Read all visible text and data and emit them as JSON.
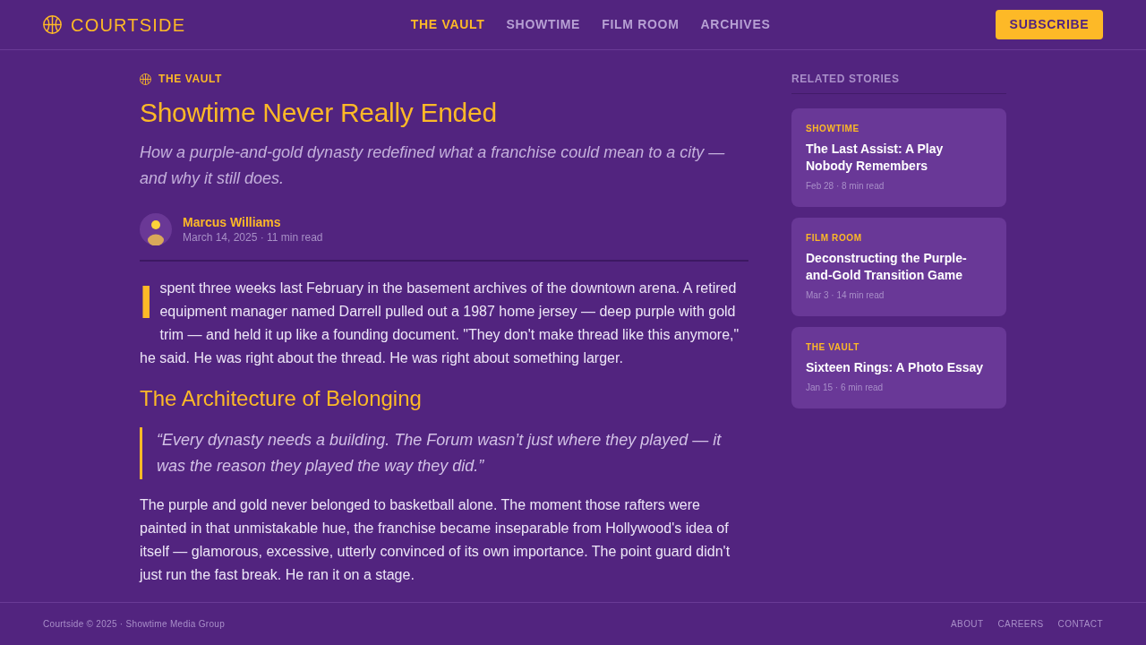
{
  "header": {
    "logo": "COURTSIDE",
    "nav": [
      {
        "label": "THE VAULT",
        "selected": true
      },
      {
        "label": "SHOWTIME",
        "selected": false
      },
      {
        "label": "FILM ROOM",
        "selected": false
      },
      {
        "label": "ARCHIVES",
        "selected": false
      }
    ],
    "subscribe": "SUBSCRIBE"
  },
  "article": {
    "kicker": "THE VAULT",
    "title": "Showtime Never Really Ended",
    "subtitle": "How a purple-and-gold dynasty redefined what a franchise could mean to a city — and why it still does.",
    "author": {
      "name": "Marcus Williams",
      "meta": "March 14, 2025 · 11 min read"
    },
    "body": [
      {
        "kind": "paragraph",
        "drop_cap": true,
        "text": "I spent three weeks last February in the basement archives of the downtown arena. A retired equipment manager named Darrell pulled out a 1987 home jersey — deep purple with gold trim — and held it up like a founding document. \"They don't make thread like this anymore,\" he said. He was right about the thread. He was right about something larger."
      },
      {
        "kind": "heading",
        "text": "The Architecture of Belonging"
      },
      {
        "kind": "quote",
        "text": "“Every dynasty needs a building. The Forum wasn’t just where they played — it was the reason they played the way they did.”"
      },
      {
        "kind": "paragraph",
        "drop_cap": false,
        "text": "The purple and gold never belonged to basketball alone. The moment those rafters were painted in that unmistakable hue, the franchise became inseparable from Hollywood's idea of itself — glamorous, excessive, utterly convinced of its own importance. The point guard didn't just run the fast break. He ran it on a stage."
      }
    ]
  },
  "sidebar": {
    "title": "RELATED STORIES",
    "stories": [
      {
        "category": "SHOWTIME",
        "title": "The Last Assist: A Play Nobody Remembers",
        "meta": "Feb 28 · 8 min read"
      },
      {
        "category": "FILM ROOM",
        "title": "Deconstructing the Purple-and-Gold Transition Game",
        "meta": "Mar 3 · 14 min read"
      },
      {
        "category": "THE VAULT",
        "title": "Sixteen Rings: A Photo Essay",
        "meta": "Jan 15 · 6 min read"
      }
    ]
  },
  "footer": {
    "copyright": "Courtside © 2025 · Showtime Media Group",
    "links": [
      "ABOUT",
      "CAREERS",
      "CONTACT"
    ]
  }
}
